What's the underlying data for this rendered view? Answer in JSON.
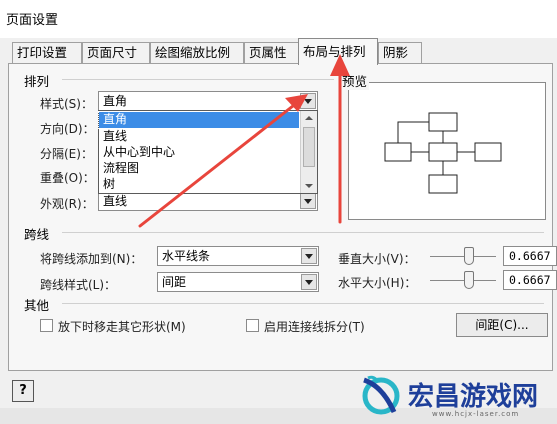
{
  "window": {
    "title": "页面设置"
  },
  "tabs": [
    "打印设置",
    "页面尺寸",
    "绘图缩放比例",
    "页属性",
    "布局与排列",
    "阴影"
  ],
  "arrange": {
    "section_title": "排列",
    "style": {
      "label": "样式(S)：",
      "value": "直角"
    },
    "direction": {
      "label": "方向(D)："
    },
    "separation": {
      "label": "分隔(E)："
    },
    "overlap": {
      "label": "重叠(O)："
    },
    "appearance": {
      "label": "外观(R)：",
      "value": "直线"
    },
    "style_options": [
      "直角",
      "直线",
      "从中心到中心",
      "流程图",
      "树"
    ]
  },
  "preview": {
    "title": "预览"
  },
  "jump": {
    "section_title": "跨线",
    "add_to": {
      "label": "将跨线添加到(N)：",
      "value": "水平线条"
    },
    "style": {
      "label": "跨线样式(L)：",
      "value": "间距"
    },
    "vertical_size": {
      "label": "垂直大小(V)：",
      "value": "0.6667"
    },
    "horizontal_size": {
      "label": "水平大小(H)：",
      "value": "0.6667"
    }
  },
  "other": {
    "section_title": "其他",
    "move_on_drop": "放下时移走其它形状(M)",
    "split_connectors": "启用连接线拆分(T)",
    "spacing_button": "间距(C)..."
  },
  "help_button": "?",
  "watermark": {
    "text": "宏昌游戏网",
    "url": "www.hcjx-laser.com"
  },
  "colors": {
    "accent_arrow": "#e8453c",
    "selection": "#3c8ce6",
    "watermark": "#1e3f9a"
  }
}
